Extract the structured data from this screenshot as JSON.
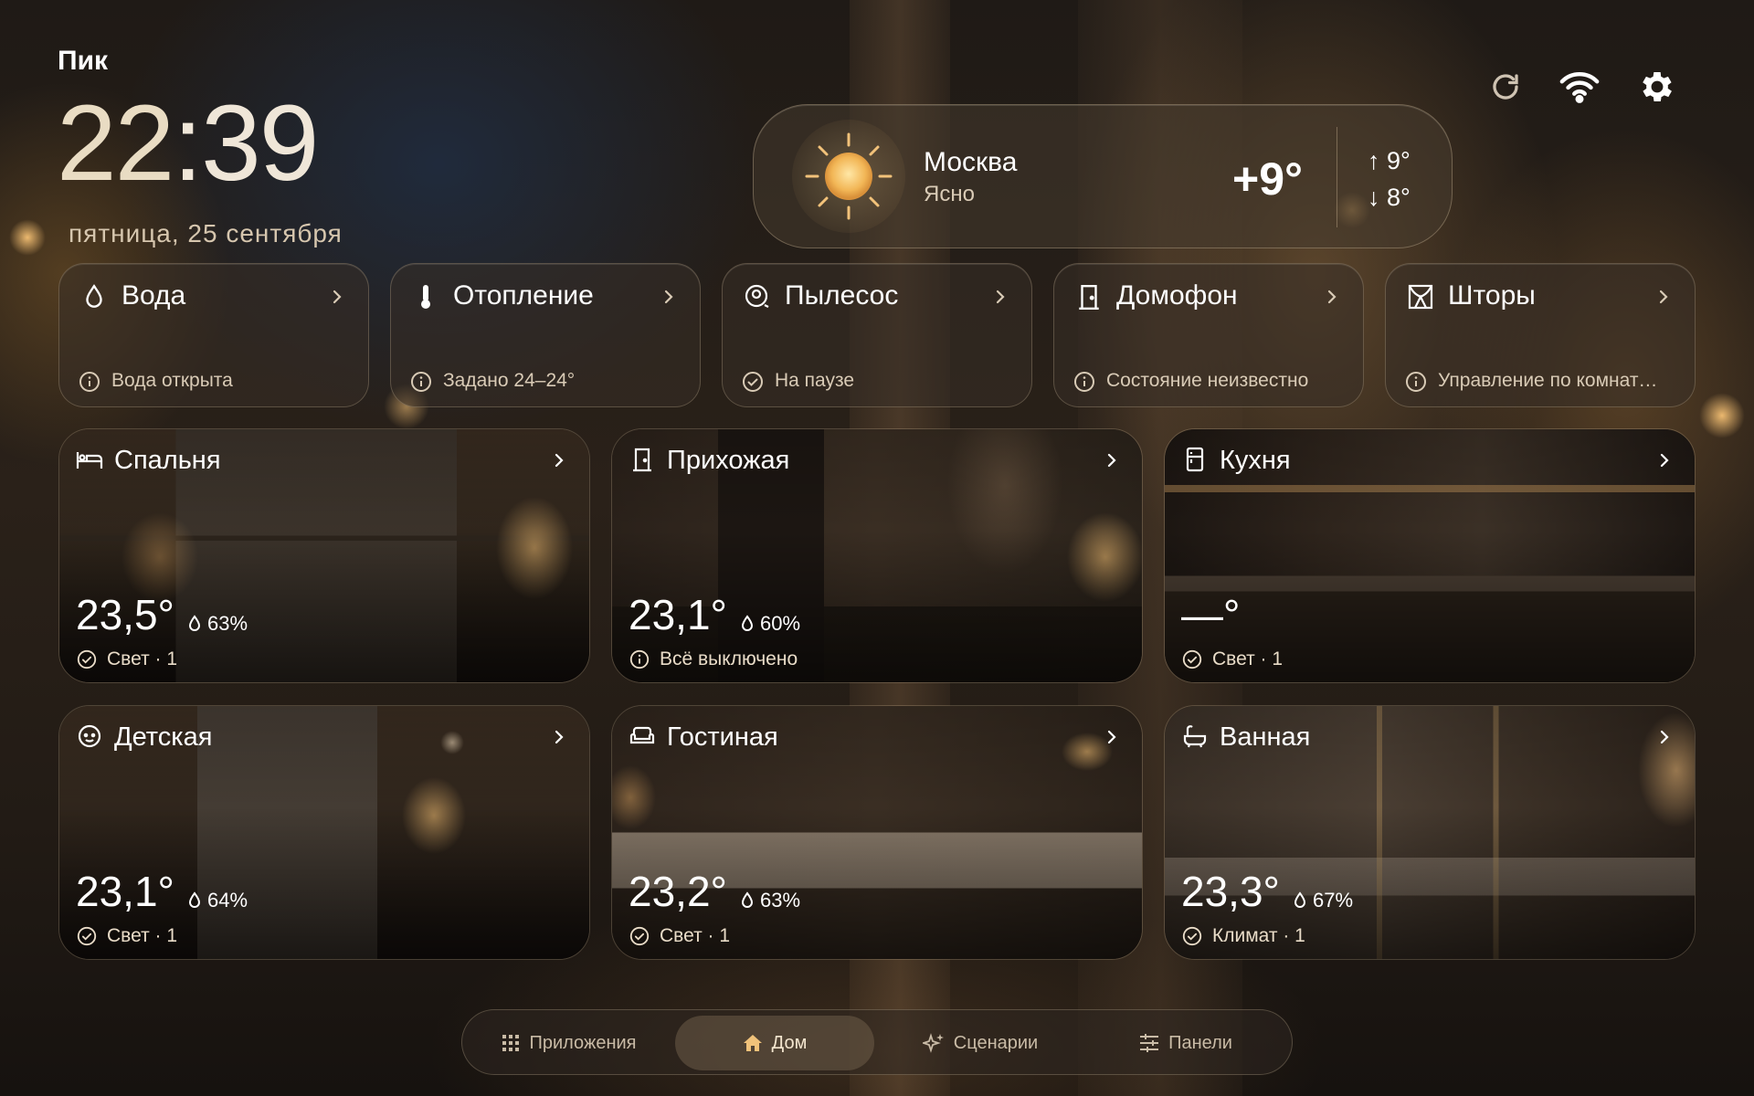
{
  "brand": "Пик",
  "clock": {
    "hours": "22",
    "sep": ":",
    "minutes": "39"
  },
  "date": "пятница, 25 сентября",
  "weather": {
    "city": "Москва",
    "condition": "Ясно",
    "temperature": "+9°",
    "high": "↑ 9°",
    "low": "↓ 8°",
    "icon": "sun-icon"
  },
  "top_icons": [
    "refresh-icon",
    "wifi-icon",
    "gear-icon"
  ],
  "devices": [
    {
      "name": "Вода",
      "icon": "water-drop-icon",
      "status_icon": "info-icon",
      "status": "Вода открыта"
    },
    {
      "name": "Отопление",
      "icon": "thermometer-icon",
      "status_icon": "info-icon",
      "status": "Задано 24–24°"
    },
    {
      "name": "Пылесос",
      "icon": "vacuum-icon",
      "status_icon": "check-circle-icon",
      "status": "На паузе"
    },
    {
      "name": "Домофон",
      "icon": "door-icon",
      "status_icon": "info-icon",
      "status": "Состояние неизвестно"
    },
    {
      "name": "Шторы",
      "icon": "curtains-icon",
      "status_icon": "info-icon",
      "status": "Управление по комнат…"
    }
  ],
  "rooms": [
    {
      "name": "Спальня",
      "icon": "bed-icon",
      "temp": "23,5°",
      "humidity": "63%",
      "status_icon": "check-circle-icon",
      "status": "Свет · 1"
    },
    {
      "name": "Прихожая",
      "icon": "door-icon",
      "temp": "23,1°",
      "humidity": "60%",
      "status_icon": "info-icon",
      "status": "Всё выключено"
    },
    {
      "name": "Кухня",
      "icon": "fridge-icon",
      "temp": "—°",
      "humidity": "",
      "status_icon": "check-circle-icon",
      "status": "Свет · 1"
    },
    {
      "name": "Детская",
      "icon": "child-face-icon",
      "temp": "23,1°",
      "humidity": "64%",
      "status_icon": "check-circle-icon",
      "status": "Свет · 1"
    },
    {
      "name": "Гостиная",
      "icon": "sofa-icon",
      "temp": "23,2°",
      "humidity": "63%",
      "status_icon": "check-circle-icon",
      "status": "Свет · 1"
    },
    {
      "name": "Ванная",
      "icon": "bathtub-icon",
      "temp": "23,3°",
      "humidity": "67%",
      "status_icon": "check-circle-icon",
      "status": "Климат · 1"
    }
  ],
  "nav": [
    {
      "label": "Приложения",
      "icon": "apps-grid-icon",
      "active": false
    },
    {
      "label": "Дом",
      "icon": "home-icon",
      "active": true
    },
    {
      "label": "Сценарии",
      "icon": "sparkle-icon",
      "active": false
    },
    {
      "label": "Панели",
      "icon": "sliders-icon",
      "active": false
    }
  ],
  "colors": {
    "accent": "#f0c27a",
    "text": "#f3ece2",
    "muted": "#d9cbb6"
  }
}
